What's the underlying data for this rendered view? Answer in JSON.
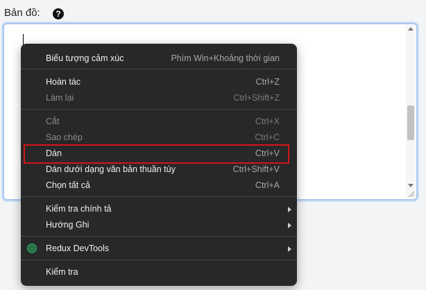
{
  "field": {
    "label": "Bản đồ:",
    "help_icon": "?"
  },
  "menu": {
    "items": [
      {
        "label": "Biểu tượng cảm xúc",
        "shortcut": "Phím Win+Khoảng thời gian",
        "enabled": true
      },
      {
        "label": "Hoàn tác",
        "shortcut": "Ctrl+Z",
        "enabled": true
      },
      {
        "label": "Làm lại",
        "shortcut": "Ctrl+Shift+Z",
        "enabled": false
      },
      {
        "label": "Cắt",
        "shortcut": "Ctrl+X",
        "enabled": false
      },
      {
        "label": "Sao chép",
        "shortcut": "Ctrl+C",
        "enabled": false
      },
      {
        "label": "Dán",
        "shortcut": "Ctrl+V",
        "enabled": true,
        "highlighted": true
      },
      {
        "label": "Dán dưới dạng văn bản thuần túy",
        "shortcut": "Ctrl+Shift+V",
        "enabled": true
      },
      {
        "label": "Chọn tất cả",
        "shortcut": "Ctrl+A",
        "enabled": true
      },
      {
        "label": "Kiểm tra chính tả",
        "submenu": true,
        "enabled": true
      },
      {
        "label": "Hướng Ghi",
        "submenu": true,
        "enabled": true
      },
      {
        "label": "Redux DevTools",
        "submenu": true,
        "enabled": true,
        "icon": "redux-devtools-icon"
      },
      {
        "label": "Kiểm tra",
        "enabled": true
      }
    ]
  },
  "colors": {
    "highlight_border": "#d4161c",
    "menu_background": "#282828",
    "focus_border": "#a9c7ee"
  }
}
